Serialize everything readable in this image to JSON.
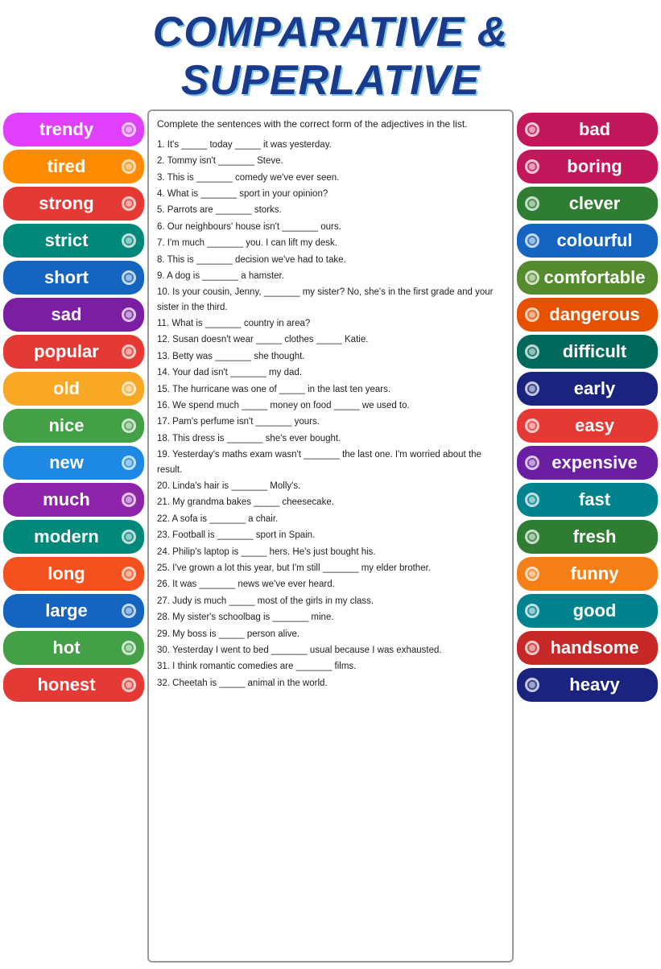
{
  "title": "COMPARATIVE & SUPERLATIVE",
  "instructions": "Complete the sentences with the correct form of the adjectives in the list.",
  "left_words": [
    {
      "text": "trendy",
      "color": "#e040fb"
    },
    {
      "text": "tired",
      "color": "#ff8c00"
    },
    {
      "text": "strong",
      "color": "#e53935"
    },
    {
      "text": "strict",
      "color": "#00897b"
    },
    {
      "text": "short",
      "color": "#1565c0"
    },
    {
      "text": "sad",
      "color": "#7b1fa2"
    },
    {
      "text": "popular",
      "color": "#e53935"
    },
    {
      "text": "old",
      "color": "#f9a825"
    },
    {
      "text": "nice",
      "color": "#43a047"
    },
    {
      "text": "new",
      "color": "#1e88e5"
    },
    {
      "text": "much",
      "color": "#8e24aa"
    },
    {
      "text": "modern",
      "color": "#00897b"
    },
    {
      "text": "long",
      "color": "#f4511e"
    },
    {
      "text": "large",
      "color": "#1565c0"
    },
    {
      "text": "hot",
      "color": "#43a047"
    },
    {
      "text": "honest",
      "color": "#e53935"
    }
  ],
  "right_words": [
    {
      "text": "bad",
      "color": "#c2185b"
    },
    {
      "text": "boring",
      "color": "#c2185b"
    },
    {
      "text": "clever",
      "color": "#2e7d32"
    },
    {
      "text": "colourful",
      "color": "#1565c0"
    },
    {
      "text": "comfortable",
      "color": "#558b2f"
    },
    {
      "text": "dangerous",
      "color": "#e65100"
    },
    {
      "text": "difficult",
      "color": "#00695c"
    },
    {
      "text": "early",
      "color": "#1a237e"
    },
    {
      "text": "easy",
      "color": "#e53935"
    },
    {
      "text": "expensive",
      "color": "#6a1fa2"
    },
    {
      "text": "fast",
      "color": "#00838f"
    },
    {
      "text": "fresh",
      "color": "#2e7d32"
    },
    {
      "text": "funny",
      "color": "#f57f17"
    },
    {
      "text": "good",
      "color": "#00838f"
    },
    {
      "text": "handsome",
      "color": "#c62828"
    },
    {
      "text": "heavy",
      "color": "#1a237e"
    }
  ],
  "sentences": [
    "1. It's _____ today _____ it was yesterday.",
    "2. Tommy isn't _______ Steve.",
    "3. This is _______ comedy we've ever seen.",
    "4. What is _______ sport in your opinion?",
    "5. Parrots are _______ storks.",
    "6. Our neighbours' house isn't _______ ours.",
    "7. I'm much _______ you. I can lift my desk.",
    "8. This is _______ decision we've had to take.",
    "9. A dog is _______ a hamster.",
    "10. Is your cousin, Jenny, _______ my sister? No, she's in the first grade and your sister in the third.",
    "11. What is _______ country in area?",
    "12. Susan doesn't wear _____ clothes _____ Katie.",
    "13. Betty was _______ she thought.",
    "14. Your dad isn't _______ my dad.",
    "15. The hurricane was one of _____ in the last ten years.",
    "16. We spend much _____ money on food _____ we used to.",
    "17. Pam's perfume isn't _______ yours.",
    "18. This dress is _______ she's ever bought.",
    "19. Yesterday's maths exam wasn't _______ the last one. I'm worried about the result.",
    "20. Linda's hair is _______ Molly's.",
    "21. My grandma bakes _____ cheesecake.",
    "22. A sofa is _______ a chair.",
    "23. Football is _______ sport in Spain.",
    "24. Philip's laptop is _____ hers. He's just bought his.",
    "25. I've grown a lot this year, but I'm still _______ my elder brother.",
    "26. It was _______ news we've ever heard.",
    "27. Judy is much _____ most of the girls in my class.",
    "28. My sister's schoolbag is _______ mine.",
    "29. My boss is _____ person alive.",
    "30. Yesterday I went to bed _______ usual because I was exhausted.",
    "31. I think romantic comedies are _______ films.",
    "32. Cheetah is _____ animal in the world."
  ]
}
